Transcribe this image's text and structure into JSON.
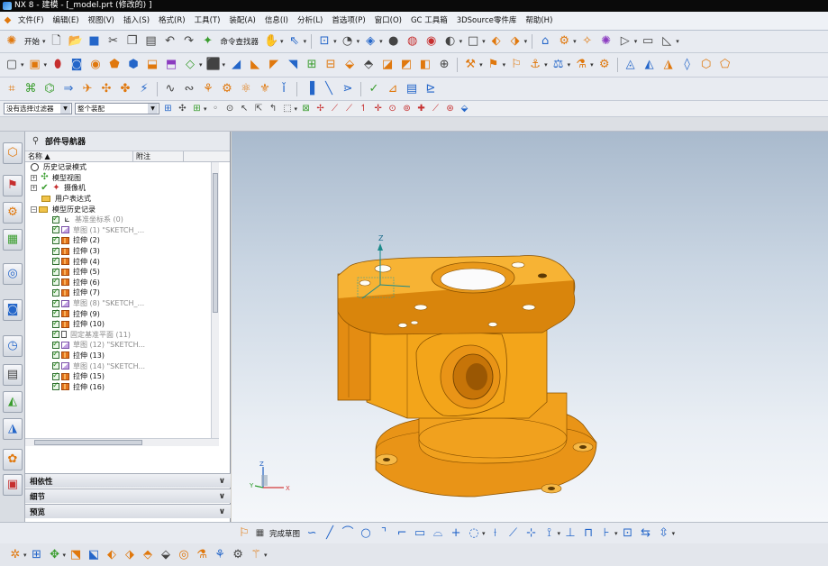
{
  "window": {
    "title": "NX 8 - 建模 - [_model.prt (修改的) ]"
  },
  "menu": [
    "文件(F)",
    "编辑(E)",
    "视图(V)",
    "插入(S)",
    "格式(R)",
    "工具(T)",
    "装配(A)",
    "信息(I)",
    "分析(L)",
    "首选项(P)",
    "窗口(O)",
    "GC 工具箱",
    "3DSource零件库",
    "帮助(H)"
  ],
  "toolbar1": {
    "start_label": "开始",
    "cmd_finder_label": "命令查找器"
  },
  "selection_bar": {
    "filter_value": "没有选择过滤器",
    "scope_value": "整个装配"
  },
  "navigator": {
    "title": "部件导航器",
    "col_name": "名称",
    "col_note": "附注",
    "rows": [
      {
        "label": "历史记录模式",
        "indent": 0,
        "icon": "clock"
      },
      {
        "label": "模型视图",
        "indent": 0,
        "icon": "views"
      },
      {
        "label": "摄像机",
        "indent": 0,
        "icon": "camera"
      },
      {
        "label": "用户表达式",
        "indent": 1,
        "icon": "folder"
      },
      {
        "label": "模型历史记录",
        "indent": 0,
        "icon": "folder"
      },
      {
        "label": "基准坐标系 (0)",
        "indent": 2,
        "icon": "datum",
        "gray": true
      },
      {
        "label": "草图 (1) \"SKETCH_...",
        "indent": 2,
        "icon": "sketch",
        "gray": true
      },
      {
        "label": "拉伸 (2)",
        "indent": 2,
        "icon": "extrude"
      },
      {
        "label": "拉伸 (3)",
        "indent": 2,
        "icon": "extrude"
      },
      {
        "label": "拉伸 (4)",
        "indent": 2,
        "icon": "extrude"
      },
      {
        "label": "拉伸 (5)",
        "indent": 2,
        "icon": "extrude"
      },
      {
        "label": "拉伸 (6)",
        "indent": 2,
        "icon": "extrude"
      },
      {
        "label": "拉伸 (7)",
        "indent": 2,
        "icon": "extrude"
      },
      {
        "label": "草图 (8) \"SKETCH_...",
        "indent": 2,
        "icon": "sketch",
        "gray": true
      },
      {
        "label": "拉伸 (9)",
        "indent": 2,
        "icon": "extrude"
      },
      {
        "label": "拉伸 (10)",
        "indent": 2,
        "icon": "extrude"
      },
      {
        "label": "固定基准平面 (11)",
        "indent": 2,
        "icon": "plane",
        "gray": true
      },
      {
        "label": "草图 (12) \"SKETCH...",
        "indent": 2,
        "icon": "sketch",
        "gray": true
      },
      {
        "label": "拉伸 (13)",
        "indent": 2,
        "icon": "extrude"
      },
      {
        "label": "草图 (14) \"SKETCH...",
        "indent": 2,
        "icon": "sketch",
        "gray": true
      },
      {
        "label": "拉伸 (15)",
        "indent": 2,
        "icon": "extrude"
      },
      {
        "label": "拉伸 (16)",
        "indent": 2,
        "icon": "extrude"
      }
    ],
    "panes": [
      "相依性",
      "细节",
      "预览"
    ]
  },
  "viewport": {
    "axis_z": "Z",
    "axis_x": "X",
    "axis_y": "Y",
    "model_color": "#f3a51a",
    "shade_color": "#d1820b"
  },
  "sketch_bar": {
    "finish_label": "完成草图"
  }
}
